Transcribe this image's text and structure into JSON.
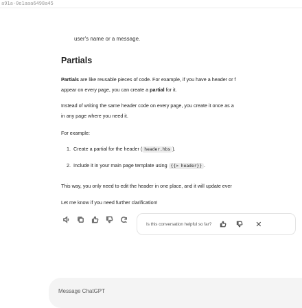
{
  "browser": {
    "tab_id": "a91a-0e1aaa6498a45"
  },
  "chat": {
    "prev_fragment": "user's name or a message.",
    "section_title": "Partials",
    "para1_bold": "Partials",
    "para1_rest": " are like reusable pieces of code. For example, if you have a header or f",
    "para1_line2_pre": "appear on every page, you can create a ",
    "para1_line2_bold": "partial",
    "para1_line2_post": " for it.",
    "para2_line1": "Instead of writing the same header code on every page, you create it once as a",
    "para2_line2": "in any page where you need it.",
    "example_label": "For example:",
    "list": [
      {
        "num": "1.",
        "pre": "Create a partial for the header (",
        "code": "header.hbs",
        "post": ")."
      },
      {
        "num": "2.",
        "pre": "Include it in your main page template using ",
        "code": "{{> header}}",
        "post": "."
      }
    ],
    "para3": "This way, you only need to edit the header in one place, and it will update ever",
    "para4": "Let me know if you need further clarification!"
  },
  "message_actions": [
    {
      "icon": "speaker-icon"
    },
    {
      "icon": "copy-icon"
    },
    {
      "icon": "thumbs-up-icon"
    },
    {
      "icon": "thumbs-down-icon"
    },
    {
      "icon": "regenerate-icon"
    }
  ],
  "feedback": {
    "question": "Is this conversation helpful so far?",
    "close": "✕"
  },
  "composer": {
    "placeholder": "Message ChatGPT"
  }
}
